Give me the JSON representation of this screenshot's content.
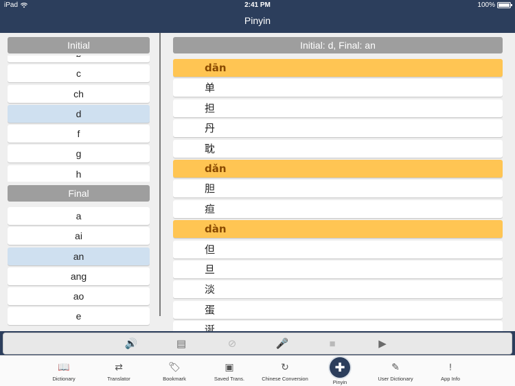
{
  "status_bar": {
    "device": "iPad",
    "time": "2:41 PM",
    "battery": "100%"
  },
  "title": "Pinyin",
  "initial": {
    "header": "Initial",
    "items": [
      "b",
      "c",
      "ch",
      "d",
      "f",
      "g",
      "h"
    ],
    "selected": "d"
  },
  "final": {
    "header": "Final",
    "items": [
      "a",
      "ai",
      "an",
      "ang",
      "ao",
      "e"
    ],
    "selected": "an"
  },
  "results": {
    "header": "Initial: d, Final: an",
    "rows": [
      {
        "text": "dān",
        "type": "pinyin"
      },
      {
        "text": "单",
        "type": "char"
      },
      {
        "text": "担",
        "type": "char"
      },
      {
        "text": "丹",
        "type": "char"
      },
      {
        "text": "耽",
        "type": "char"
      },
      {
        "text": "dǎn",
        "type": "pinyin"
      },
      {
        "text": "胆",
        "type": "char"
      },
      {
        "text": "疸",
        "type": "char"
      },
      {
        "text": "dàn",
        "type": "pinyin"
      },
      {
        "text": "但",
        "type": "char"
      },
      {
        "text": "旦",
        "type": "char"
      },
      {
        "text": "淡",
        "type": "char"
      },
      {
        "text": "蛋",
        "type": "char"
      },
      {
        "text": "诞",
        "type": "char"
      }
    ]
  },
  "toolbar": [
    {
      "name": "speaker-button",
      "icon": "speaker-icon",
      "glyph": "🔊",
      "enabled": true
    },
    {
      "name": "document-audio-button",
      "icon": "document-audio-icon",
      "glyph": "▤",
      "enabled": true
    },
    {
      "name": "mute-button",
      "icon": "mute-icon",
      "glyph": "⊘",
      "enabled": false
    },
    {
      "name": "microphone-button",
      "icon": "microphone-icon",
      "glyph": "🎤",
      "enabled": true
    },
    {
      "name": "stop-button",
      "icon": "stop-icon",
      "glyph": "■",
      "enabled": false
    },
    {
      "name": "play-button",
      "icon": "play-icon",
      "glyph": "▶",
      "enabled": true
    }
  ],
  "tabs": [
    {
      "label": "Dictionary",
      "icon": "book-icon",
      "glyph": "📖",
      "active": false
    },
    {
      "label": "Translator",
      "icon": "translate-icon",
      "glyph": "⇄",
      "active": false
    },
    {
      "label": "Bookmark",
      "icon": "tag-icon",
      "glyph": "🏷",
      "active": false
    },
    {
      "label": "Saved Trans.",
      "icon": "saved-icon",
      "glyph": "▣",
      "active": false
    },
    {
      "label": "Chinese Conversion",
      "icon": "conversion-icon",
      "glyph": "↻",
      "active": false
    },
    {
      "label": "Pinyin",
      "icon": "pinyin-icon",
      "glyph": "✚",
      "active": true
    },
    {
      "label": "User Dictionary",
      "icon": "user-dictionary-icon",
      "glyph": "✎",
      "active": false
    },
    {
      "label": "App Info",
      "icon": "info-icon",
      "glyph": "!",
      "active": false
    }
  ],
  "colors": {
    "header_bg": "#2c3e5c",
    "pinyin_row": "#ffc553",
    "selected_row": "#cfe0f0",
    "section_header": "#9e9e9e"
  }
}
